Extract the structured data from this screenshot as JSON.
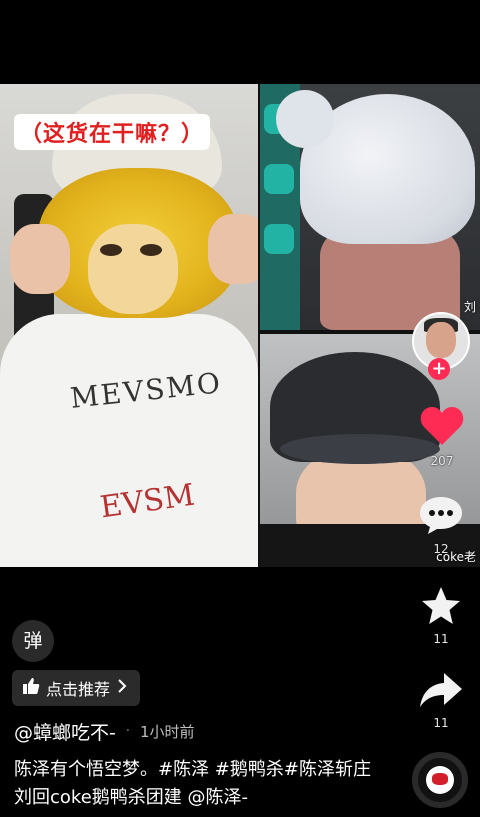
{
  "video": {
    "overlay_caption": "（这货在干嘛？）",
    "right_top_label": "刘",
    "right_bottom_label": "coke老"
  },
  "rail": {
    "like_count": "207",
    "comment_count": "12",
    "favorite_count": "11",
    "share_count": "11",
    "accent_color": "#fe2c55"
  },
  "bottom": {
    "danmaku_label": "弹",
    "recommend_label": "点击推荐",
    "author": "@蟑螂吃不-",
    "time": "1小时前",
    "description": "陈泽有个悟空梦。#陈泽 #鹅鸭杀#陈泽斩庄刘回coke鹅鸭杀团建 @陈泽-"
  }
}
